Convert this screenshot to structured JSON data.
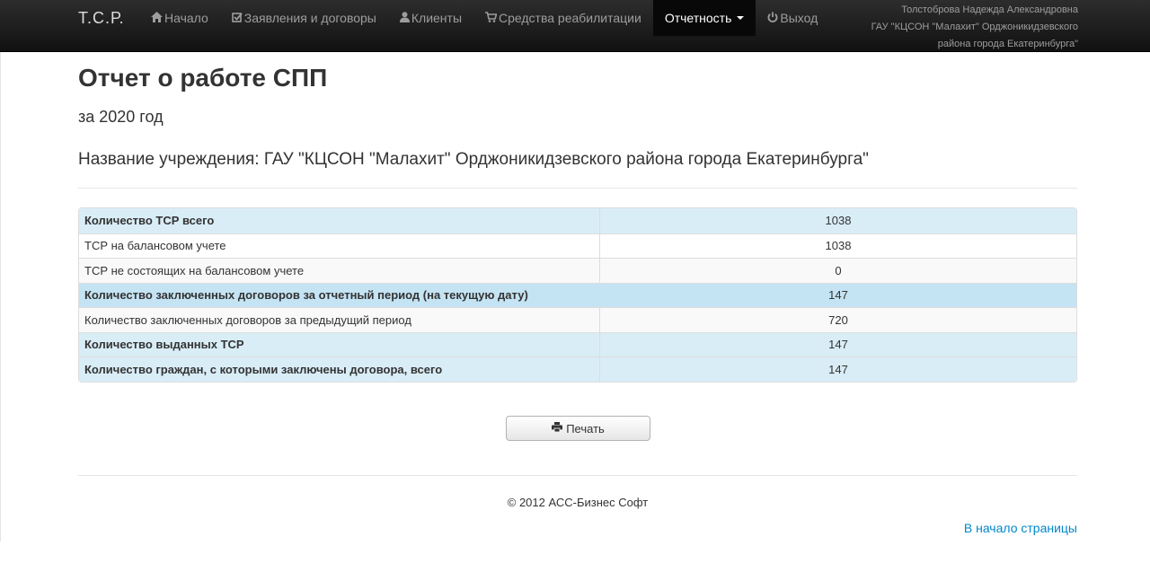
{
  "navbar": {
    "brand": "Т.С.Р.",
    "items": [
      {
        "icon": "home-icon",
        "glyph": "⌂",
        "label": "Начало",
        "active": false
      },
      {
        "icon": "edit-icon",
        "glyph": "☑",
        "label": "Заявления и договоры",
        "active": false
      },
      {
        "icon": "user-icon",
        "glyph": "●",
        "label": "Клиенты",
        "active": false
      },
      {
        "icon": "cart-icon",
        "glyph": "🛒",
        "label": "Средства реабилитации",
        "active": false
      },
      {
        "icon": "",
        "glyph": "",
        "label": "Отчетность",
        "active": true
      },
      {
        "icon": "power-icon",
        "glyph": "⏻",
        "label": "Выход",
        "active": false
      }
    ],
    "user_name": "Толстоброва Надежда Александровна",
    "user_org_line1": "ГАУ \"КЦСОН \"Малахит\" Орджоникидзевского",
    "user_org_line2": "района города Екатеринбурга\""
  },
  "page": {
    "title": "Отчет о работе СПП",
    "year_text": "за 2020 год",
    "org_text": "Название учреждения: ГАУ \"КЦСОН \"Малахит\" Орджоникидзевского района города Екатеринбурга\""
  },
  "report": {
    "rows": [
      {
        "label": "Количество ТСР всего",
        "value": "1038"
      },
      {
        "label": "ТСР на балансовом учете",
        "value": "1038"
      },
      {
        "label": "ТСР не состоящих на балансовом учете",
        "value": "0"
      },
      {
        "label": "Количество заключенных договоров за отчетный период (на текущую дату)",
        "value": "147"
      },
      {
        "label": "Количество заключенных договоров за предыдущий период",
        "value": "720"
      },
      {
        "label": "Количество выданных ТСР",
        "value": "147"
      },
      {
        "label": "Количество граждан, с которыми заключены договора, всего",
        "value": "147"
      }
    ]
  },
  "actions": {
    "print_label": "Печать",
    "print_icon": "printer-icon"
  },
  "footer": {
    "copyright": "© 2012 АСС-Бизнес Софт",
    "to_top": "В начало страницы"
  },
  "colors": {
    "navbar": "#1b1b1b",
    "row_info": "#d9edf7",
    "row_info_strong": "#c4e3f3",
    "link": "#0088cc"
  }
}
